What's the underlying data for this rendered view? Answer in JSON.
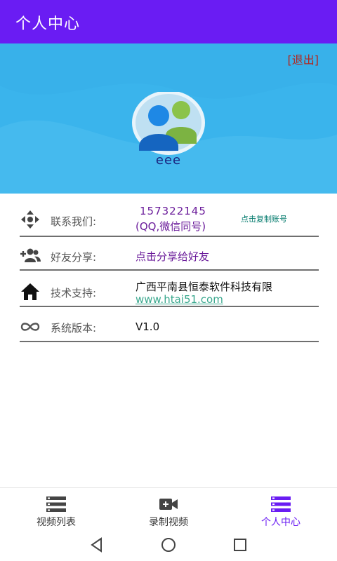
{
  "app_bar": {
    "title": "个人中心"
  },
  "profile": {
    "logout_label": "[退出]",
    "username": "eee"
  },
  "info": {
    "contact": {
      "label": "联系我们:",
      "qq_number": "157322145",
      "qq_note": "(QQ,微信同号)",
      "copy_label": "点击复制账号"
    },
    "share": {
      "label": "好友分享:",
      "value": "点击分享给好友"
    },
    "support": {
      "label": "技术支持:",
      "company": "广西平南县恒泰软件科技有限",
      "website": "www.htai51.com"
    },
    "version": {
      "label": "系统版本:",
      "value": "V1.0"
    }
  },
  "bottom_nav": {
    "items": [
      {
        "label": "视频列表",
        "icon": "list-icon"
      },
      {
        "label": "录制视频",
        "icon": "video-camera-icon"
      },
      {
        "label": "个人中心",
        "icon": "list-icon",
        "active": true
      }
    ]
  },
  "theme": {
    "primary": "#6a1cf3",
    "hero": "#3ab4ec",
    "accent_text": "#6a1b9a",
    "link": "#3aa88e",
    "logout": "#b3261e"
  }
}
